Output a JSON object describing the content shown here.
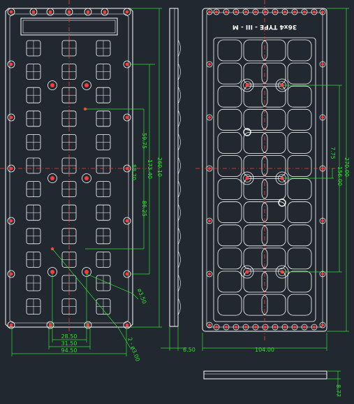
{
  "drawing": {
    "type_label": "36x4 TYPE - III - M",
    "colors": {
      "background": "#212830",
      "outline": "#ffffff",
      "dimension": "#2fe02f",
      "centerline": "#ff3b3b",
      "hole": "#ff3b3b"
    },
    "front_view": {
      "lens_rows": 12,
      "lens_cols": 3,
      "dims": {
        "w_inner": "28.50",
        "w_mid": "31.50",
        "w_outer": "94.50",
        "h_pitch_a": "59.75",
        "h_pitch_b": "173.40",
        "h_pitch_c": "88.70",
        "h_pitch_d": "86.25",
        "h_total": "260.10",
        "hole_dia": "ø3.50",
        "hole_note": "2 - ø3.00"
      }
    },
    "side_view": {
      "dims": {
        "thickness": "6.50"
      }
    },
    "back_view": {
      "lens_rows": 12,
      "lens_cols": 4,
      "dims": {
        "width": "104.00",
        "h_a": "7.75",
        "h_b": "156.00",
        "h_total": "270.00"
      }
    },
    "bottom_view": {
      "dims": {
        "height": "8.77"
      }
    }
  }
}
